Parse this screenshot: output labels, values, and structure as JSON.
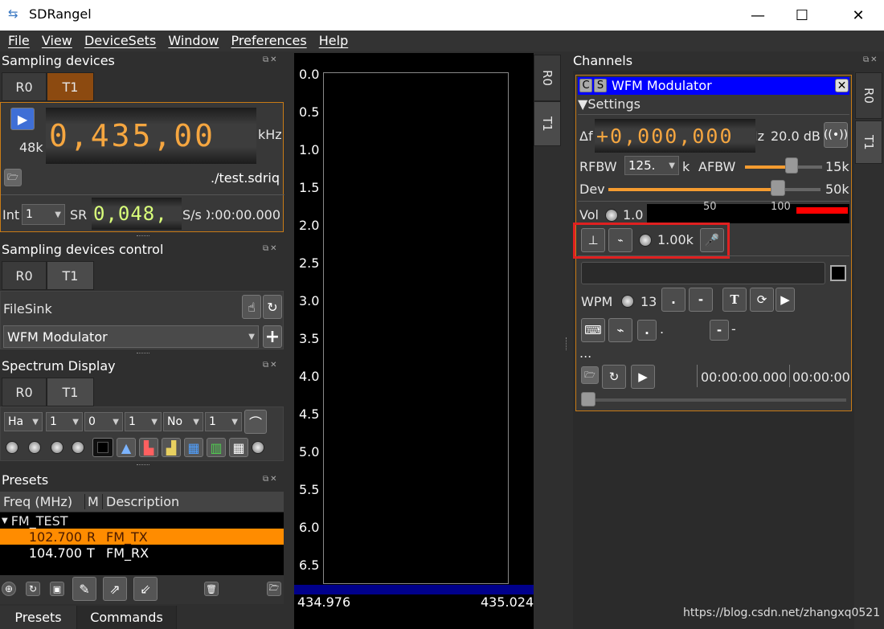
{
  "window": {
    "title": "SDRangel",
    "min": "—",
    "max": "☐",
    "close": "✕"
  },
  "menu": [
    "File",
    "View",
    "DeviceSets",
    "Window",
    "Preferences",
    "Help"
  ],
  "sampling": {
    "title": "Sampling devices",
    "tabs": [
      "R0",
      "T1"
    ],
    "freq_digits": "0,435,00",
    "freq_unit": "kHz",
    "rate": "48k",
    "file": "./test.sdriq",
    "int_label": "Int",
    "int_value": "1",
    "sr_label": "SR",
    "sr_digits": "0,048,",
    "sr_unit": "S/s",
    "time": "00:00:00.000"
  },
  "sampling_control": {
    "title": "Sampling devices control",
    "tabs": [
      "R0",
      "T1"
    ],
    "device": "FileSink",
    "channel_select": "WFM Modulator",
    "add": "+"
  },
  "spectrum_display": {
    "title": "Spectrum Display",
    "tabs": [
      "R0",
      "T1"
    ],
    "combos": [
      "Ha",
      "1",
      "0",
      "1",
      "No",
      "1"
    ]
  },
  "presets": {
    "title": "Presets",
    "headers": [
      "Freq (MHz)",
      "M",
      "Description"
    ],
    "group": "FM_TEST",
    "rows": [
      {
        "freq": "102.700",
        "m": "R",
        "desc": "FM_TX"
      },
      {
        "freq": "104.700",
        "m": "T",
        "desc": "FM_RX"
      }
    ]
  },
  "bottom_tabs": [
    "Presets",
    "Commands"
  ],
  "spectrum": {
    "y_ticks": [
      "0.0",
      "0.5",
      "1.0",
      "1.5",
      "2.0",
      "2.5",
      "3.0",
      "3.5",
      "4.0",
      "4.5",
      "5.0",
      "5.5",
      "6.0",
      "6.5"
    ],
    "x_left": "434.976",
    "x_right": "435.024",
    "vtabs": [
      "R0",
      "T1"
    ]
  },
  "channels": {
    "title": "Channels",
    "vtabs": [
      "R0",
      "T1"
    ],
    "mod": {
      "c": "C",
      "s": "S",
      "title": "WFM Modulator",
      "settings": "Settings",
      "delta_label": "Δf",
      "delta_digits": "+0,000,000",
      "delta_unit": "Hz",
      "power": "20.0 dB",
      "rfbw_label": "RFBW",
      "rfbw_value": "125.",
      "rfbw_unit": "k",
      "afbw_label": "AFBW",
      "afbw_value": "15k",
      "dev_label": "Dev",
      "dev_value": "50k",
      "vol_label": "Vol",
      "vol_value": "1.0",
      "meter_ticks": [
        "50",
        "100"
      ],
      "tone_value": "1.00k",
      "wpm_label": "WPM",
      "wpm_value": "13",
      "dot": ".",
      "dash": "-",
      "dot_text": ".",
      "dash_text": "-",
      "ellipsis": "...",
      "play_time": "00:00:00.000",
      "play_time2": "00:00:00"
    }
  },
  "progress": {
    "afbw_fraction": 0.6,
    "dev_fraction": 0.8
  },
  "watermark": "https://blog.csdn.net/zhangxq0521",
  "colors": {
    "accent_orange": "#f59c30",
    "title_blue": "#0000ff",
    "highlight_red": "#e02020",
    "preset_selected": "#ff8c00",
    "meter_red": "#ff0000"
  }
}
